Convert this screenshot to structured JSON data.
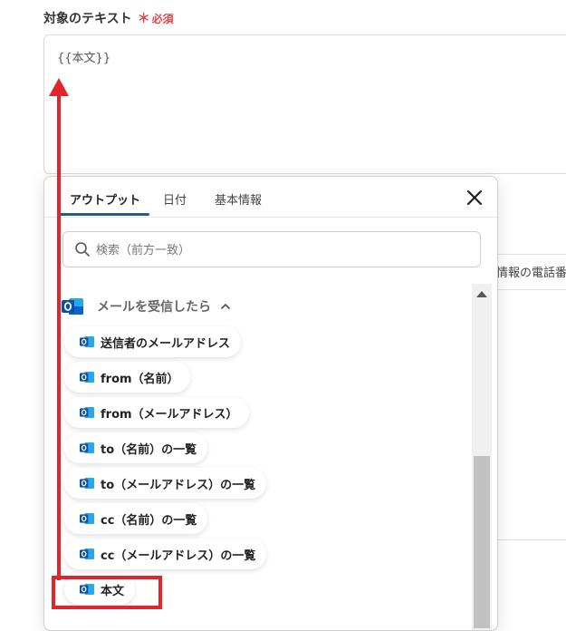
{
  "field": {
    "label": "対象のテキスト",
    "required_mark": "＊",
    "required_text": "必須",
    "value": "{{本文}}"
  },
  "background": {
    "partial_text": "情報の電話番"
  },
  "popup": {
    "tabs": [
      {
        "label": "アウトプット"
      },
      {
        "label": "日付"
      },
      {
        "label": "基本情報"
      }
    ],
    "search_placeholder": "検索（前方一致）",
    "section_title": "メールを受信したら",
    "items": [
      {
        "label": "送信者のメールアドレス"
      },
      {
        "label": "from（名前）"
      },
      {
        "label": "from（メールアドレス）"
      },
      {
        "label": "to（名前）の一覧"
      },
      {
        "label": "to（メールアドレス）の一覧"
      },
      {
        "label": "cc（名前）の一覧"
      },
      {
        "label": "cc（メールアドレス）の一覧"
      },
      {
        "label": "本文"
      }
    ]
  },
  "icons": {
    "outlook": "outlook-icon",
    "search": "search-icon",
    "close": "close-icon",
    "chevron": "chevron-up-icon"
  },
  "colors": {
    "accent": "#1f5f8b",
    "highlight": "#e0262b",
    "required": "#e0474c",
    "outlook_blue": "#0a64c8"
  }
}
